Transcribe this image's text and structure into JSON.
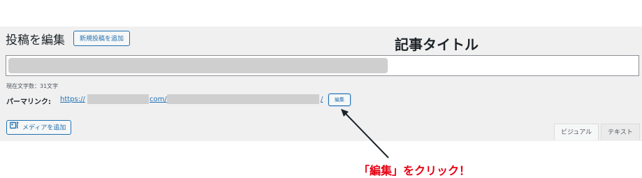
{
  "header": {
    "page_title": "投稿を編集",
    "add_new_label": "新規投稿を追加"
  },
  "annotations": {
    "title_label": "記事タイトル",
    "click_hint": "「編集」をクリック！",
    "arrow_color": "#1d2327",
    "hint_color": "#e60012"
  },
  "title_field": {
    "value": ""
  },
  "word_count": {
    "text": "現在文字数：31文字"
  },
  "permalink": {
    "label": "パーマリンク:",
    "prefix": "https://",
    "domain_suffix": "com/",
    "trailing_slash": "/",
    "edit_label": "編集"
  },
  "toolbar": {
    "add_media_label": "メディアを追加",
    "tabs": [
      {
        "label": "ビジュアル",
        "active": true
      },
      {
        "label": "テキスト",
        "active": false
      }
    ]
  },
  "colors": {
    "accent": "#2271b1",
    "background": "#f0f0f1",
    "redaction": "#cfcfcf"
  }
}
